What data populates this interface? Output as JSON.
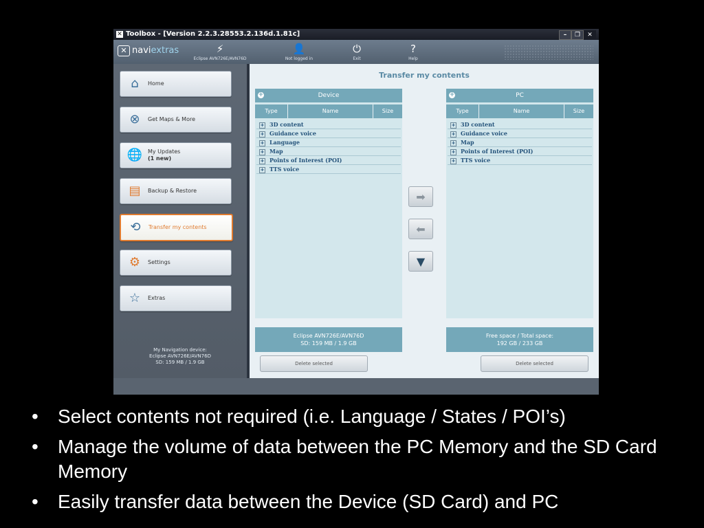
{
  "window": {
    "title": "Toolbox - [Version 2.2.3.28553.2.136d.1.81c]"
  },
  "header": {
    "logo_text_a": "navi",
    "logo_text_b": "extras",
    "device_label": "Eclipse AVN726E/AVN76D",
    "login_label": "Not logged in",
    "exit_label": "Exit",
    "help_label": "Help"
  },
  "sidebar": {
    "items": [
      {
        "label": "Home"
      },
      {
        "label": "Get Maps & More"
      },
      {
        "label": "My Updates",
        "sub": "(1 new)"
      },
      {
        "label": "Backup & Restore"
      },
      {
        "label": "Transfer my contents"
      },
      {
        "label": "Settings"
      },
      {
        "label": "Extras"
      }
    ],
    "device_info": {
      "line1": "My Navigation device:",
      "line2": "Eclipse AVN726E/AVN76D",
      "line3": "SD: 159 MB / 1.9 GB"
    }
  },
  "main": {
    "title": "Transfer my contents",
    "device_panel": {
      "header": "Device",
      "columns": [
        "Type",
        "Name",
        "Size"
      ],
      "rows": [
        "3D content",
        "Guidance voice",
        "Language",
        "Map",
        "Points of Interest (POI)",
        "TTS voice"
      ],
      "info_line1": "Eclipse AVN726E/AVN76D",
      "info_line2": "SD: 159 MB / 1.9 GB",
      "delete_label": "Delete selected"
    },
    "pc_panel": {
      "header": "PC",
      "columns": [
        "Type",
        "Name",
        "Size"
      ],
      "rows": [
        "3D content",
        "Guidance voice",
        "Map",
        "Points of Interest (POI)",
        "TTS voice"
      ],
      "info_line1": "Free space / Total space:",
      "info_line2": "192 GB / 233 GB",
      "delete_label": "Delete selected"
    }
  },
  "bullets": [
    "Select contents not required (i.e. Language / States / POI’s)",
    "Manage the volume of data between the PC Memory and the SD Card Memory",
    "Easily transfer data between the Device (SD Card) and PC"
  ]
}
